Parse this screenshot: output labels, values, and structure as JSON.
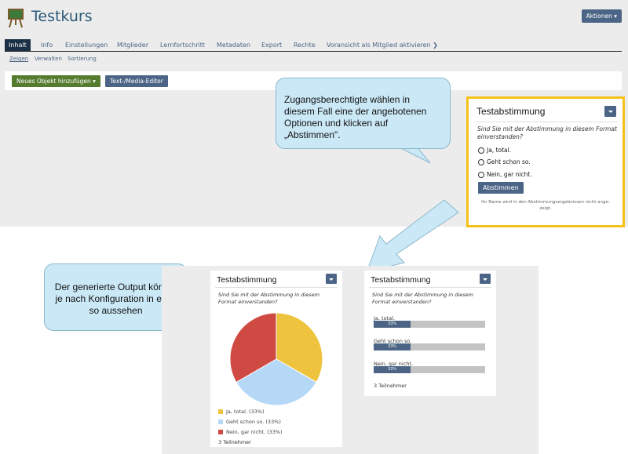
{
  "course": {
    "title": "Testkurs",
    "actions_label": "Aktionen ▾"
  },
  "tabs": [
    {
      "label": "Inhalt"
    },
    {
      "label": "Info"
    },
    {
      "label": "Einstellungen"
    },
    {
      "label": "Mitglieder"
    },
    {
      "label": "Lernfortschritt"
    },
    {
      "label": "Metadaten"
    },
    {
      "label": "Export"
    },
    {
      "label": "Rechte"
    },
    {
      "label": "Voransicht als Mitglied aktivieren ❯"
    }
  ],
  "subtabs": [
    {
      "label": "Zeigen"
    },
    {
      "label": "Verwalten"
    },
    {
      "label": "Sortierung"
    }
  ],
  "toolbar": {
    "add_object_label": "Neues Objekt hinzufügen ▾",
    "editor_label": "Text-/Media-Editor"
  },
  "callouts": {
    "top": "Zugangsberechtigte wählen in diesem Fall eine der angebotenen Optionen und klicken auf „Abstimmen\".",
    "bottom": "Der generierte Output könnte je nach Konfiguration in etwa so aussehen"
  },
  "poll": {
    "title": "Testabstimmung",
    "question": "Sind Sie mit der Abstimmung in diesem Format einverstanden?",
    "options": [
      {
        "label": "Ja, total."
      },
      {
        "label": "Geht schon so."
      },
      {
        "label": "Nein, gar nicht."
      }
    ],
    "vote_label": "Abstimmen",
    "note": "Ihr Name wird in den Abstimmungsergebnissen nicht ange-zeigt."
  },
  "results": {
    "participants": "3 Teilnehmer",
    "legend": [
      {
        "label": "Ja, total. (33%)",
        "color": "#eec43f"
      },
      {
        "label": "Geht schon so. (33%)",
        "color": "#b5d8f7"
      },
      {
        "label": "Nein, gar nicht. (33%)",
        "color": "#d04a44"
      }
    ],
    "bars": [
      {
        "label": "Ja, total.",
        "value_text": "33%",
        "fraction": 0.33
      },
      {
        "label": "Geht schon so.",
        "value_text": "33%",
        "fraction": 0.33
      },
      {
        "label": "Nein, gar nicht.",
        "value_text": "33%",
        "fraction": 0.33
      }
    ]
  },
  "colors": {
    "primary": "#4c6586",
    "success": "#557b2e",
    "highlight": "#f6c219",
    "callout": "#cbe8f6"
  }
}
